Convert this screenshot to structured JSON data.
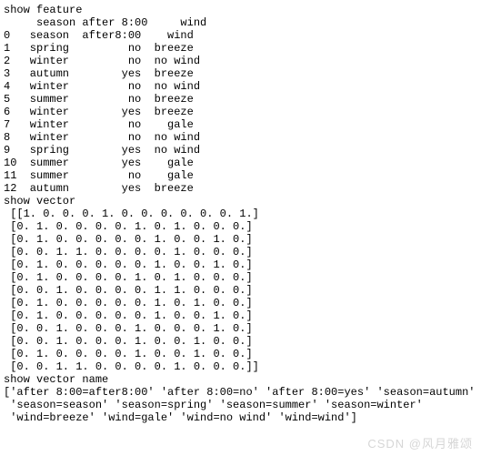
{
  "heading1": "show feature",
  "table": {
    "header": "     season after 8:00     wind",
    "rows": [
      "0   season  after8:00    wind",
      "1   spring         no  breeze",
      "2   winter         no  no wind",
      "3   autumn        yes  breeze",
      "4   winter         no  no wind",
      "5   summer         no  breeze",
      "6   winter        yes  breeze",
      "7   winter         no    gale",
      "8   winter         no  no wind",
      "9   spring        yes  no wind",
      "10  summer        yes    gale",
      "11  summer         no    gale",
      "12  autumn        yes  breeze"
    ]
  },
  "heading2": "show vector",
  "matrix": [
    " [[1. 0. 0. 0. 1. 0. 0. 0. 0. 0. 0. 1.]",
    " [0. 1. 0. 0. 0. 0. 1. 0. 1. 0. 0. 0.]",
    " [0. 1. 0. 0. 0. 0. 0. 1. 0. 0. 1. 0.]",
    " [0. 0. 1. 1. 0. 0. 0. 0. 1. 0. 0. 0.]",
    " [0. 1. 0. 0. 0. 0. 0. 1. 0. 0. 1. 0.]",
    " [0. 1. 0. 0. 0. 0. 1. 0. 1. 0. 0. 0.]",
    " [0. 0. 1. 0. 0. 0. 0. 1. 1. 0. 0. 0.]",
    " [0. 1. 0. 0. 0. 0. 0. 1. 0. 1. 0. 0.]",
    " [0. 1. 0. 0. 0. 0. 0. 1. 0. 0. 1. 0.]",
    " [0. 0. 1. 0. 0. 0. 1. 0. 0. 0. 1. 0.]",
    " [0. 0. 1. 0. 0. 0. 1. 0. 0. 1. 0. 0.]",
    " [0. 1. 0. 0. 0. 0. 1. 0. 0. 1. 0. 0.]",
    " [0. 0. 1. 1. 0. 0. 0. 0. 1. 0. 0. 0.]]"
  ],
  "heading3": "show vector name",
  "namesLines": [
    "['after 8:00=after8:00' 'after 8:00=no' 'after 8:00=yes' 'season=autumn'",
    " 'season=season' 'season=spring' 'season=summer' 'season=winter'",
    " 'wind=breeze' 'wind=gale' 'wind=no wind' 'wind=wind']"
  ],
  "watermark": "CSDN @风月雅颂"
}
